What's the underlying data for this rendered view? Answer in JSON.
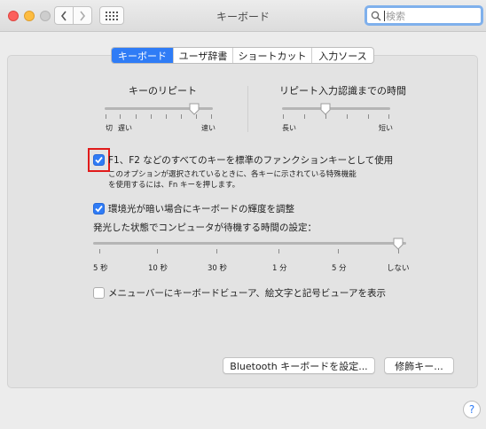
{
  "window": {
    "title": "キーボード"
  },
  "search": {
    "placeholder": "検索"
  },
  "tabs": [
    {
      "label": "キーボード",
      "active": true
    },
    {
      "label": "ユーザ辞書",
      "active": false
    },
    {
      "label": "ショートカット",
      "active": false
    },
    {
      "label": "入力ソース",
      "active": false
    }
  ],
  "key_repeat": {
    "title": "キーのリピート",
    "left_label": "切",
    "left_label2": "遅い",
    "right_label": "速い"
  },
  "delay_until_repeat": {
    "title": "リピート入力認識までの時間",
    "left_label": "長い",
    "right_label": "短い"
  },
  "fn_keys": {
    "label": "F1、F2 などのすべてのキーを標準のファンクションキーとして使用",
    "desc_line1": "このオプションが選択されているときに、各キーに示されている特殊機能",
    "desc_line2": "を使用するには、Fn キーを押します。",
    "checked": true
  },
  "backlight": {
    "label": "環境光が暗い場合にキーボードの輝度を調整",
    "checked": true
  },
  "idle": {
    "title": "発光した状態でコンピュータが待機する時間の設定：",
    "ticks": [
      "5 秒",
      "10 秒",
      "30 秒",
      "1 分",
      "5 分",
      "しない"
    ]
  },
  "viewer": {
    "label": "メニューバーにキーボードビューア、絵文字と記号ビューアを表示",
    "checked": false
  },
  "buttons": {
    "bluetooth": "Bluetooth キーボードを設定...",
    "modifier": "修飾キー..."
  },
  "help": {
    "label": "?"
  },
  "colors": {
    "accent": "#2f7cf6",
    "highlight_box": "#e11b1b"
  }
}
